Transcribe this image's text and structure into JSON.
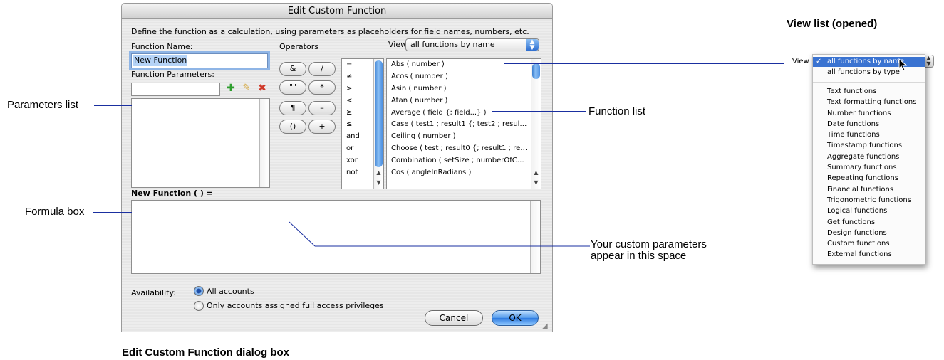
{
  "dialog": {
    "title": "Edit Custom Function",
    "instructions": "Define the function as a calculation, using parameters as placeholders for field names, numbers, etc.",
    "function_name_label": "Function Name:",
    "function_name_value": "New Function",
    "function_parameters_label": "Function Parameters:",
    "parameter_input_value": "",
    "operators_label": "Operators",
    "view_label": "View",
    "view_selected": "all functions by name",
    "operator_buttons": [
      "&",
      "/",
      "\"\"",
      "*",
      "¶",
      "–",
      "()",
      "+"
    ],
    "operator_list": [
      "=",
      "≠",
      ">",
      "<",
      "≥",
      "≤",
      "and",
      "or",
      "xor",
      "not"
    ],
    "function_list": [
      "Abs ( number )",
      "Acos ( number )",
      "Asin ( number )",
      "Atan ( number )",
      "Average ( field {; field...} )",
      "Case ( test1 ; result1 {; test2 ; resul…",
      "Ceiling ( number )",
      "Choose ( test ; result0 {; result1 ; re…",
      "Combination ( setSize ; numberOfC…",
      "Cos ( angleInRadians )"
    ],
    "formula_label": "New Function ( ) =",
    "formula_text": "",
    "availability_label": "Availability:",
    "availability_options": [
      "All accounts",
      "Only accounts assigned full access privileges"
    ],
    "availability_selected_index": 0,
    "cancel_label": "Cancel",
    "ok_label": "OK"
  },
  "callouts": {
    "parameters_list": "Parameters list",
    "formula_box": "Formula box",
    "function_list": "Function list",
    "custom_params_line1": "Your custom parameters",
    "custom_params_line2": "appear in this space"
  },
  "caption": "Edit Custom Function dialog box",
  "view_list_panel": {
    "heading": "View list (opened)",
    "view_label": "View",
    "checkmark": "✓",
    "selected": "all functions by name",
    "items": [
      "all functions by name",
      "all functions by type"
    ],
    "categories": [
      "Text functions",
      "Text formatting functions",
      "Number functions",
      "Date functions",
      "Time functions",
      "Timestamp functions",
      "Aggregate functions",
      "Summary functions",
      "Repeating functions",
      "Financial functions",
      "Trigonometric functions",
      "Logical functions",
      "Get functions",
      "Design functions",
      "Custom functions",
      "External functions"
    ]
  },
  "colors": {
    "callout_line": "#1a2fa0",
    "highlight_blue": "#3a73d1",
    "selection_bg": "#b5d3f7",
    "add_icon": "#2e9e2e",
    "delete_icon": "#d03a2a"
  }
}
